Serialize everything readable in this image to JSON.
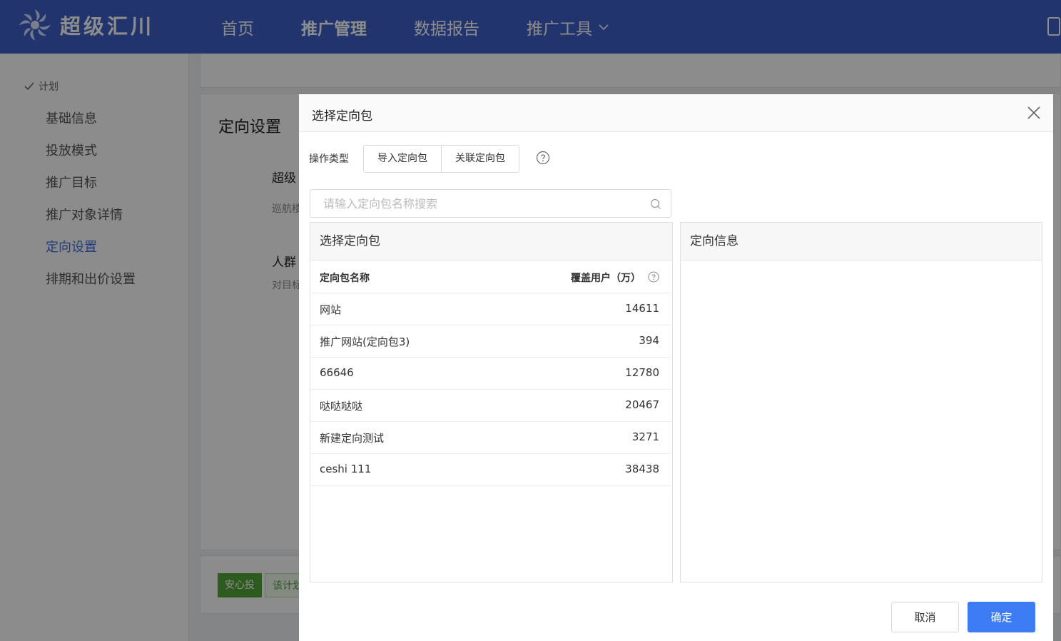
{
  "app": {
    "logo_text": "超级汇川"
  },
  "nav": {
    "items": [
      {
        "label": "首页"
      },
      {
        "label": "推广管理"
      },
      {
        "label": "数据报告"
      },
      {
        "label": "推广工具"
      }
    ]
  },
  "sidebar": {
    "group": "计划",
    "items": [
      {
        "label": "基础信息"
      },
      {
        "label": "投放模式"
      },
      {
        "label": "推广目标"
      },
      {
        "label": "推广对象详情"
      },
      {
        "label": "定向设置"
      },
      {
        "label": "排期和出价设置"
      }
    ]
  },
  "background": {
    "card_title": "定向设置",
    "heading1": "超级",
    "sub1": "巡航楼",
    "heading2": "人群",
    "sub2": "对目标",
    "tag_label": "安心投",
    "tag_tail": "该计划"
  },
  "modal": {
    "title": "选择定向包",
    "op_label": "操作类型",
    "op_buttons": [
      "导入定向包",
      "关联定向包"
    ],
    "search_placeholder": "请输入定向包名称搜索",
    "left_panel_title": "选择定向包",
    "right_panel_title": "定向信息",
    "columns": {
      "name": "定向包名称",
      "coverage": "覆盖用户（万）"
    },
    "rows": [
      {
        "name": "网站",
        "coverage": "14611"
      },
      {
        "name": "推广网站(定向包3)",
        "coverage": "394"
      },
      {
        "name": "66646",
        "coverage": "12780"
      },
      {
        "name": "哒哒哒哒",
        "coverage": "20467"
      },
      {
        "name": "新建定向测试",
        "coverage": "3271"
      },
      {
        "name": "ceshi 111",
        "coverage": "38438"
      }
    ],
    "cancel_label": "取消",
    "ok_label": "确定"
  },
  "colors": {
    "nav_bg": "#3f5fc9",
    "primary": "#3d7cf5",
    "active_link": "#3f6fe0",
    "tag_green": "#52a43a"
  }
}
